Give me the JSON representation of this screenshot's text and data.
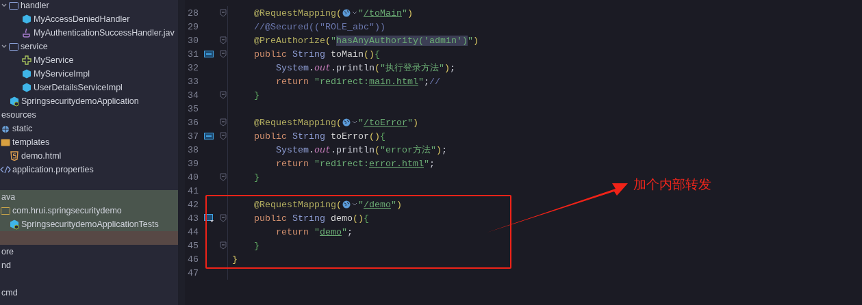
{
  "tree_top": [
    {
      "label": "handler",
      "kind": "folder",
      "expanded": true,
      "selected": false,
      "children": [
        {
          "label": "MyAccessDeniedHandler",
          "kind": "class",
          "selected": false
        },
        {
          "label": "MyAuthenticationSuccessHandler.jav",
          "kind": "java",
          "selected": false
        }
      ]
    },
    {
      "label": "service",
      "kind": "folder",
      "expanded": true,
      "selected": false,
      "children": [
        {
          "label": "MyService",
          "kind": "interface",
          "selected": false
        },
        {
          "label": "MyServiceImpl",
          "kind": "class",
          "selected": false
        },
        {
          "label": "UserDetailsServiceImpl",
          "kind": "class",
          "selected": false
        }
      ]
    },
    {
      "label": "SpringsecuritydemoApplication",
      "kind": "app",
      "selected": false
    }
  ],
  "tree": [
    {
      "label": "esources",
      "selected": false,
      "children": [
        {
          "label": "static",
          "kind": "web-folder",
          "selected": false
        },
        {
          "label": "templates",
          "kind": "template-folder",
          "selected": false,
          "children": [
            {
              "label": "demo.html",
              "kind": "html",
              "selected": false
            }
          ]
        },
        {
          "label": "application.properties",
          "kind": "properties",
          "selected": false
        }
      ]
    },
    {
      "kind": "blank"
    },
    {
      "label": "ava",
      "selected": true,
      "children": [
        {
          "label": "com.hrui.springsecuritydemo",
          "kind": "package",
          "selected": true,
          "children": [
            {
              "label": "SpringsecuritydemoApplicationTests",
              "kind": "app",
              "selected": true
            }
          ]
        }
      ]
    },
    {
      "kind": "blank",
      "highlighted": true
    },
    {
      "label": "ore",
      "selected": false
    },
    {
      "label": "nd",
      "selected": false
    },
    {
      "kind": "blank"
    },
    {
      "label": "cmd",
      "selected": false
    }
  ],
  "code_lines": [
    {
      "number": "28",
      "fold": true,
      "kind": "member",
      "tokens": [
        {
          "kind": "annotation",
          "text": "@RequestMapping"
        },
        {
          "kind": "paren",
          "text": "("
        },
        {
          "kind": "inlay"
        },
        {
          "kind": "string",
          "text": "\""
        },
        {
          "kind": "link",
          "text": "/toMain"
        },
        {
          "kind": "string",
          "text": "\""
        },
        {
          "kind": "paren",
          "text": ")"
        }
      ]
    },
    {
      "number": "29",
      "fold": false,
      "kind": "member",
      "tokens": [
        {
          "kind": "comment",
          "text": "//@Secured((\"ROLE_abc\"))"
        }
      ]
    },
    {
      "number": "30",
      "fold": true,
      "kind": "member",
      "tokens": [
        {
          "kind": "annotation",
          "text": "@PreAuthorize"
        },
        {
          "kind": "paren",
          "text": "("
        },
        {
          "kind": "string",
          "text": "\""
        },
        {
          "kind": "highlight",
          "text": "hasAnyAuthority('admin')"
        },
        {
          "kind": "string",
          "text": "\""
        },
        {
          "kind": "paren",
          "text": ")"
        }
      ]
    },
    {
      "number": "31",
      "fold": true,
      "kind": "member",
      "gutter": {
        "kind": "method"
      },
      "tokens": [
        {
          "kind": "keyword",
          "text": "public "
        },
        {
          "kind": "type",
          "text": "String "
        },
        {
          "kind": "method",
          "text": "toMain"
        },
        {
          "kind": "paren",
          "text": "()"
        },
        {
          "kind": "brace",
          "text": "{"
        }
      ]
    },
    {
      "number": "32",
      "fold": false,
      "kind": "body",
      "tokens": [
        {
          "kind": "type",
          "text": "System"
        },
        {
          "kind": "plain",
          "text": "."
        },
        {
          "kind": "field",
          "text": "out"
        },
        {
          "kind": "plain",
          "text": ".println"
        },
        {
          "kind": "paren",
          "text": "("
        },
        {
          "kind": "string",
          "text": "\"执行登录方法\""
        },
        {
          "kind": "paren",
          "text": ")"
        },
        {
          "kind": "plain",
          "text": ";"
        }
      ]
    },
    {
      "number": "33",
      "fold": false,
      "kind": "body",
      "tokens": [
        {
          "kind": "keyword",
          "text": "return "
        },
        {
          "kind": "string",
          "text": "\"redirect:"
        },
        {
          "kind": "link",
          "text": "main.html"
        },
        {
          "kind": "string",
          "text": "\""
        },
        {
          "kind": "plain",
          "text": ";"
        },
        {
          "kind": "comment",
          "text": "//"
        }
      ]
    },
    {
      "number": "34",
      "fold": true,
      "kind": "member",
      "tokens": [
        {
          "kind": "brace",
          "text": "}"
        }
      ]
    },
    {
      "number": "35",
      "fold": false,
      "kind": "member"
    },
    {
      "number": "36",
      "fold": true,
      "kind": "member",
      "tokens": [
        {
          "kind": "annotation",
          "text": "@RequestMapping"
        },
        {
          "kind": "paren",
          "text": "("
        },
        {
          "kind": "inlay"
        },
        {
          "kind": "string",
          "text": "\""
        },
        {
          "kind": "link",
          "text": "/toError"
        },
        {
          "kind": "string",
          "text": "\""
        },
        {
          "kind": "paren",
          "text": ")"
        }
      ]
    },
    {
      "number": "37",
      "fold": true,
      "kind": "member",
      "gutter": {
        "kind": "method"
      },
      "tokens": [
        {
          "kind": "keyword",
          "text": "public "
        },
        {
          "kind": "type",
          "text": "String "
        },
        {
          "kind": "method",
          "text": "toError"
        },
        {
          "kind": "paren",
          "text": "()"
        },
        {
          "kind": "brace",
          "text": "{"
        }
      ]
    },
    {
      "number": "38",
      "fold": false,
      "kind": "body",
      "tokens": [
        {
          "kind": "type",
          "text": "System"
        },
        {
          "kind": "plain",
          "text": "."
        },
        {
          "kind": "field",
          "text": "out"
        },
        {
          "kind": "plain",
          "text": ".println"
        },
        {
          "kind": "paren",
          "text": "("
        },
        {
          "kind": "string",
          "text": "\"error方法\""
        },
        {
          "kind": "paren",
          "text": ")"
        },
        {
          "kind": "plain",
          "text": ";"
        }
      ]
    },
    {
      "number": "39",
      "fold": false,
      "kind": "body",
      "tokens": [
        {
          "kind": "keyword",
          "text": "return "
        },
        {
          "kind": "string",
          "text": "\"redirect:"
        },
        {
          "kind": "link",
          "text": "error.html"
        },
        {
          "kind": "string",
          "text": "\""
        },
        {
          "kind": "plain",
          "text": ";"
        }
      ]
    },
    {
      "number": "40",
      "fold": true,
      "kind": "member",
      "tokens": [
        {
          "kind": "brace",
          "text": "}"
        }
      ]
    },
    {
      "number": "41",
      "fold": false,
      "kind": "member"
    },
    {
      "number": "42",
      "fold": false,
      "kind": "member",
      "tokens": [
        {
          "kind": "annotation",
          "text": "@RequestMapping"
        },
        {
          "kind": "paren",
          "text": "("
        },
        {
          "kind": "inlay"
        },
        {
          "kind": "string",
          "text": "\""
        },
        {
          "kind": "link",
          "text": "/demo"
        },
        {
          "kind": "string",
          "text": "\""
        },
        {
          "kind": "paren",
          "text": ")"
        }
      ]
    },
    {
      "number": "43",
      "fold": true,
      "kind": "member",
      "gutter": {
        "kind": "method-down"
      },
      "tokens": [
        {
          "kind": "keyword",
          "text": "public "
        },
        {
          "kind": "type",
          "text": "String "
        },
        {
          "kind": "method",
          "text": "demo"
        },
        {
          "kind": "paren",
          "text": "()"
        },
        {
          "kind": "brace",
          "text": "{"
        }
      ]
    },
    {
      "number": "44",
      "fold": false,
      "kind": "body",
      "tokens": [
        {
          "kind": "keyword",
          "text": "return "
        },
        {
          "kind": "string",
          "text": "\""
        },
        {
          "kind": "link",
          "text": "demo"
        },
        {
          "kind": "string",
          "text": "\""
        },
        {
          "kind": "plain",
          "text": ";"
        }
      ]
    },
    {
      "number": "45",
      "fold": true,
      "kind": "member",
      "tokens": [
        {
          "kind": "brace",
          "text": "}"
        }
      ]
    },
    {
      "number": "46",
      "fold": false,
      "kind": "top",
      "tokens": [
        {
          "kind": "paren",
          "text": "}"
        }
      ]
    },
    {
      "number": "47",
      "fold": false,
      "kind": "top"
    }
  ],
  "callout": {
    "label": "加个内部转发"
  }
}
